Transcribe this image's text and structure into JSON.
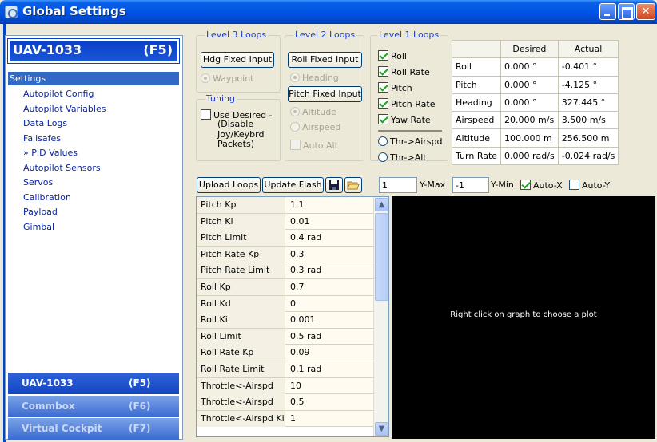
{
  "window": {
    "title": "Global Settings"
  },
  "sidebar": {
    "title": "UAV-1033",
    "hotkey": "(F5)",
    "selected": "Settings",
    "items": [
      "Autopilot Config",
      "Autopilot Variables",
      "Data Logs",
      "Failsafes",
      "» PID Values",
      "Autopilot Sensors",
      "Servos",
      "Calibration",
      "Payload",
      "Gimbal"
    ],
    "bottom": [
      {
        "label": "UAV-1033",
        "hotkey": "(F5)"
      },
      {
        "label": "Commbox",
        "hotkey": "(F6)"
      },
      {
        "label": "Virtual Cockpit",
        "hotkey": "(F7)"
      }
    ]
  },
  "level3": {
    "title": "Level 3 Loops",
    "button": "Hdg Fixed Input",
    "radio": "Waypoint"
  },
  "tuning": {
    "title": "Tuning",
    "checkbox_lines": [
      "Use Desired -",
      "(Disable",
      "Joy/Keybrd",
      "Packets)"
    ]
  },
  "level2": {
    "title": "Level 2 Loops",
    "roll_button": "Roll Fixed Input",
    "heading_radio": "Heading",
    "pitch_button": "Pitch Fixed Input",
    "altitude_radio": "Altitude",
    "airspeed_radio": "Airspeed",
    "autoalt_check": "Auto Alt"
  },
  "level1": {
    "title": "Level 1 Loops",
    "checks": [
      "Roll",
      "Roll Rate",
      "Pitch",
      "Pitch Rate",
      "Yaw Rate"
    ],
    "radios": [
      "Thr->Airspd",
      "Thr->Alt"
    ]
  },
  "state_table": {
    "headers": [
      "",
      "Desired",
      "Actual"
    ],
    "rows": [
      [
        "Roll",
        "0.000 °",
        "-0.401 °"
      ],
      [
        "Pitch",
        "0.000 °",
        "-4.125 °"
      ],
      [
        "Heading",
        "0.000 °",
        "327.445 °"
      ],
      [
        "Airspeed",
        "20.000 m/s",
        "3.500 m/s"
      ],
      [
        "Altitude",
        "100.000 m",
        "256.500 m"
      ],
      [
        "Turn Rate",
        "0.000 rad/s",
        "-0.024 rad/s"
      ]
    ]
  },
  "toolbar": {
    "upload": "Upload Loops",
    "update": "Update Flash",
    "ymax_value": "1",
    "ymax_label": "Y-Max",
    "ymin_value": "-1",
    "ymin_label": "Y-Min",
    "autox": "Auto-X",
    "autoy": "Auto-Y"
  },
  "pid": [
    [
      "Pitch Kp",
      "1.1"
    ],
    [
      "Pitch Ki",
      "0.01"
    ],
    [
      "Pitch Limit",
      "0.4 rad"
    ],
    [
      "Pitch Rate Kp",
      "0.3"
    ],
    [
      "Pitch Rate Limit",
      "0.3 rad"
    ],
    [
      "Roll Kp",
      "0.7"
    ],
    [
      "Roll Kd",
      "0"
    ],
    [
      "Roll Ki",
      "0.001"
    ],
    [
      "Roll Limit",
      "0.5 rad"
    ],
    [
      "Roll Rate Kp",
      "0.09"
    ],
    [
      "Roll Rate Limit",
      "0.1 rad"
    ],
    [
      "Throttle<-Airspd Kp",
      "10"
    ],
    [
      "Throttle<-Airspd Kd",
      "0.5"
    ],
    [
      "Throttle<-Airspd Ki",
      "1"
    ]
  ],
  "graph": {
    "message": "Right click on graph to choose a plot"
  }
}
